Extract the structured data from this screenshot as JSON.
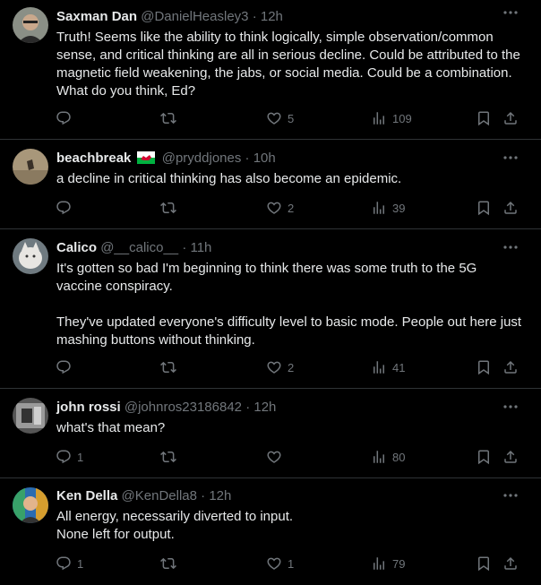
{
  "tweets": [
    {
      "name": "Saxman Dan",
      "handle": "@DanielHeasley3",
      "time": "12h",
      "text": "Truth! Seems like the ability to think logically, simple observation/common sense, and critical thinking are all in serious decline. Could be attributed to the magnetic field weakening, the jabs, or social media. Could be a combination. What do you think, Ed?",
      "replies": "",
      "retweets": "",
      "likes": "5",
      "views": "109"
    },
    {
      "name": "beachbreak",
      "handle": "@pryddjones",
      "time": "10h",
      "text": "a decline in critical thinking has also become an epidemic.",
      "replies": "",
      "retweets": "",
      "likes": "2",
      "views": "39"
    },
    {
      "name": "Calico",
      "handle": "@__calico__",
      "time": "11h",
      "text": "It's gotten so bad I'm beginning to think there was some truth to the 5G vaccine conspiracy.\n\nThey've updated everyone's difficulty level to basic mode. People out here just mashing buttons without thinking.",
      "replies": "",
      "retweets": "",
      "likes": "2",
      "views": "41"
    },
    {
      "name": "john rossi",
      "handle": "@johnros23186842",
      "time": "12h",
      "text": "what's that mean?",
      "replies": "1",
      "retweets": "",
      "likes": "",
      "views": "80"
    },
    {
      "name": "Ken Della",
      "handle": "@KenDella8",
      "time": "12h",
      "text": "All energy, necessarily diverted to input.\nNone left for output.",
      "replies": "1",
      "retweets": "",
      "likes": "1",
      "views": "79"
    }
  ],
  "separator": "·",
  "icons": {
    "reply": "reply-icon",
    "retweet": "retweet-icon",
    "like": "heart-icon",
    "views": "views-chart-icon",
    "bookmark": "bookmark-icon",
    "share": "share-icon",
    "more": "more-icon",
    "flag": "wales-flag-icon"
  },
  "colors": {
    "background": "#000000",
    "text": "#e7e9ea",
    "secondary": "#71767b",
    "divider": "#2f3336"
  }
}
